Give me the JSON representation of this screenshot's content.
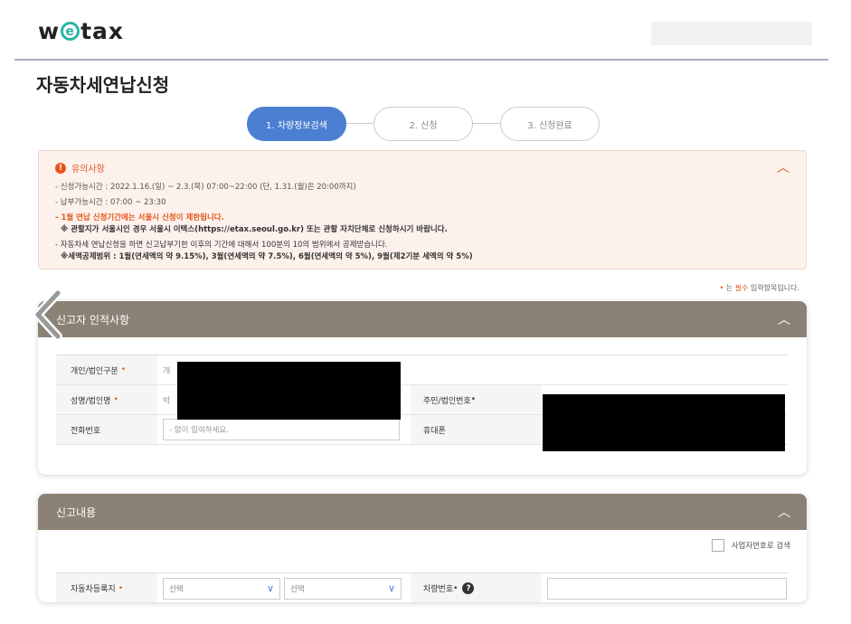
{
  "header": {
    "logo_pre": "w",
    "logo_e": "e",
    "logo_post": "tax",
    "page_title": "자동차세연납신청"
  },
  "steps": [
    {
      "label": "1. 차량정보검색",
      "active": true
    },
    {
      "label": "2. 신청",
      "active": false
    },
    {
      "label": "3. 신청완료",
      "active": false
    }
  ],
  "notice": {
    "title": "유의사항",
    "line1": "- 신청가능시간 : 2022.1.16.(일) ~ 2.3.(목) 07:00~22:00 (단, 1.31.(월)은 20:00까지)",
    "line2": "- 납부가능시간 : 07:00 ~ 23:30",
    "line3": "- 1월 연납 신청기간에는 서울시 신청이 제한됩니다.",
    "line4": "※ 관할지가 서울시인 경우 서울시 이택스(https://etax.seoul.go.kr) 또는 관할 자치단체로 신청하시기 바랍니다.",
    "line5": "- 자동차세 연납신청을 하면 신고납부기한 이후의 기간에 대해서 100분의 10의 범위에서 공제받습니다.",
    "line6": "※세액공제범위 : 1월(연세액의 약 9.15%), 3월(연세액의 약 7.5%), 6월(연세액의 약 5%), 9월(제2기분 세액의 약 5%)"
  },
  "required_note": {
    "dot": "•",
    "pre": " 는 ",
    "req": "필수",
    "post": " 입력항목입니다."
  },
  "reporter_panel": {
    "title": "신고자 인적사항",
    "rows": [
      {
        "label": "개인/법인구분",
        "value_hint": "개"
      },
      {
        "label": "성명/법인명",
        "value_hint": "박",
        "label2": "주민/법인번호"
      },
      {
        "label": "전화번호",
        "placeholder": "- 없이 입력하세요.",
        "label2": "휴대폰"
      }
    ],
    "required_mark": "•"
  },
  "report_panel": {
    "title": "신고내용",
    "checkbox_label": "사업자번호로 검색",
    "row_label": "자동차등록지",
    "select1": "선택",
    "select2": "선택",
    "label2": "차량번호",
    "required_mark": "•",
    "help": "?"
  },
  "icons": {
    "collapse": "chevron-up-icon",
    "warning": "exclamation-icon",
    "back": "chevron-left-icon",
    "select_arrow": "chevron-down-icon"
  },
  "colors": {
    "accent": "#4b7fd1",
    "warning": "#e0581d",
    "panel_header": "#8b8275",
    "logo_e": "#2bb3a7"
  }
}
